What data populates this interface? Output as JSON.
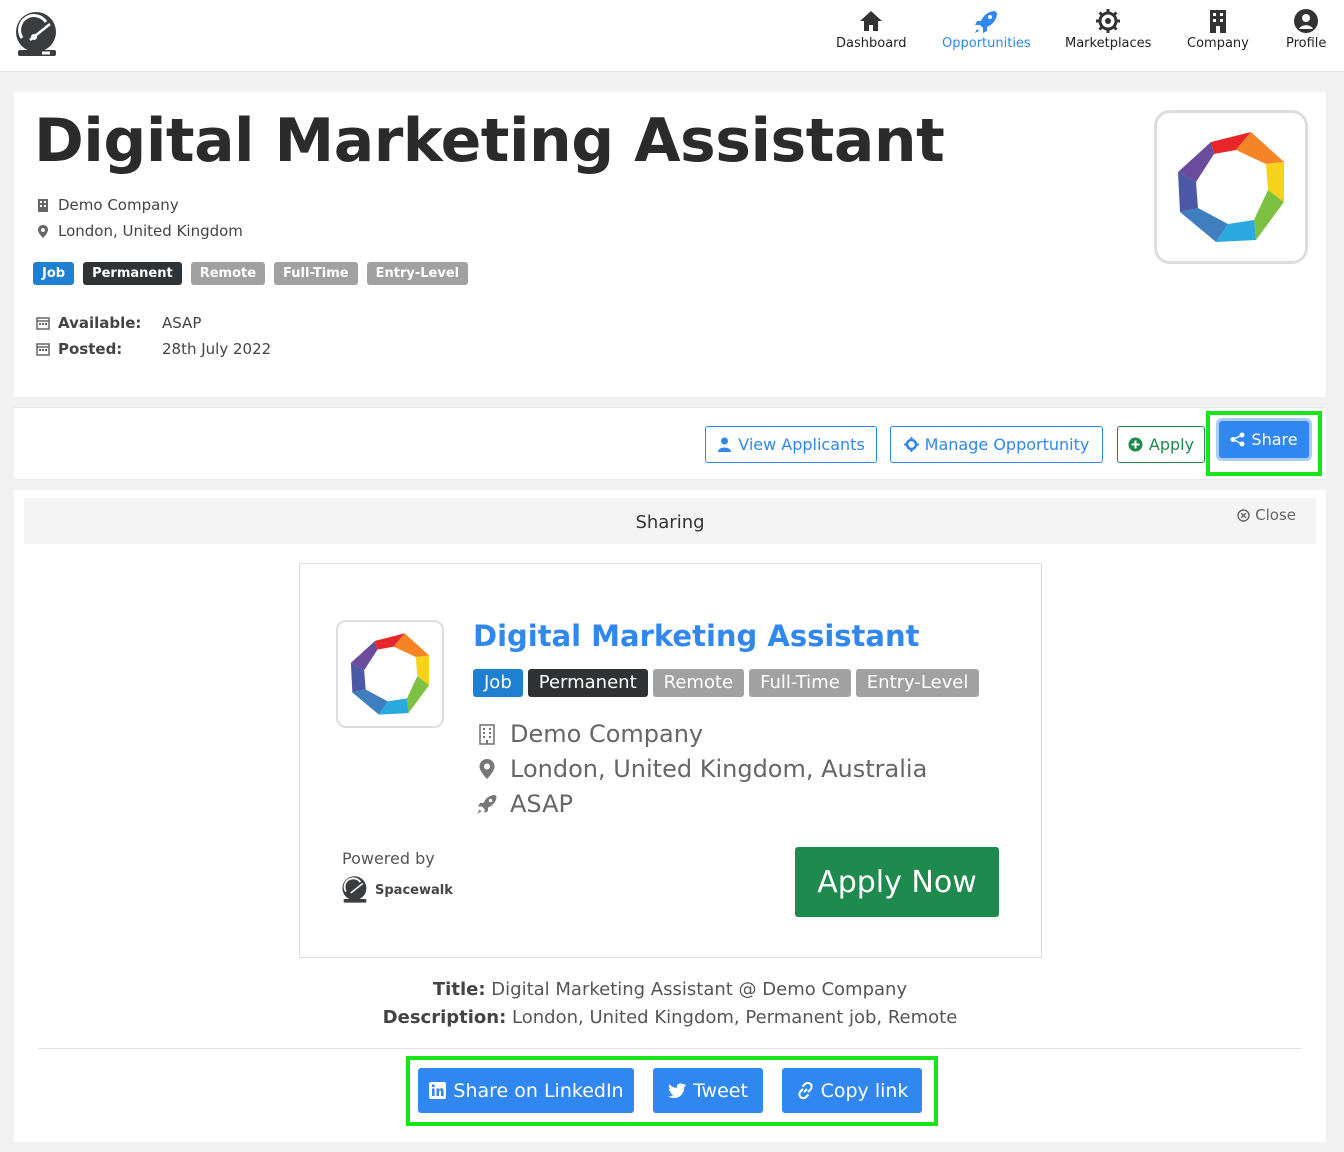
{
  "nav": {
    "items": [
      {
        "label": "Dashboard",
        "icon": "home-icon"
      },
      {
        "label": "Opportunities",
        "icon": "rocket-icon",
        "active": true
      },
      {
        "label": "Marketplaces",
        "icon": "gear-icon"
      },
      {
        "label": "Company",
        "icon": "building-icon"
      },
      {
        "label": "Profile",
        "icon": "user-circle-icon"
      }
    ]
  },
  "job": {
    "title": "Digital Marketing Assistant",
    "company": "Demo Company",
    "location": "London, United Kingdom",
    "tags": [
      "Job",
      "Permanent",
      "Remote",
      "Full-Time",
      "Entry-Level"
    ],
    "available_label": "Available:",
    "available_value": "ASAP",
    "posted_label": "Posted:",
    "posted_value": "28th July 2022"
  },
  "actions": {
    "view_applicants": "View Applicants",
    "manage": "Manage Opportunity",
    "apply": "Apply",
    "share": "Share"
  },
  "sharing": {
    "header": "Sharing",
    "close": "Close",
    "preview": {
      "title": "Digital Marketing Assistant",
      "tags": [
        "Job",
        "Permanent",
        "Remote",
        "Full-Time",
        "Entry-Level"
      ],
      "company": "Demo Company",
      "location": "London, United Kingdom, Australia",
      "availability": "ASAP",
      "powered_by": "Powered by",
      "brand": "Spacewalk",
      "apply_now": "Apply Now"
    },
    "title_label": "Title:",
    "title_value": "Digital Marketing Assistant @ Demo Company",
    "description_label": "Description:",
    "description_value": "London, United Kingdom, Permanent job, Remote",
    "buttons": {
      "linkedin": "Share on LinkedIn",
      "tweet": "Tweet",
      "copy": "Copy link"
    }
  },
  "colors": {
    "primary": "#2f87ef",
    "success": "#1f8a4e",
    "highlight": "#17e51a",
    "tag_blue": "#1f7fd0",
    "tag_dark": "#2f3336",
    "tag_grey": "#a1a1a1"
  }
}
